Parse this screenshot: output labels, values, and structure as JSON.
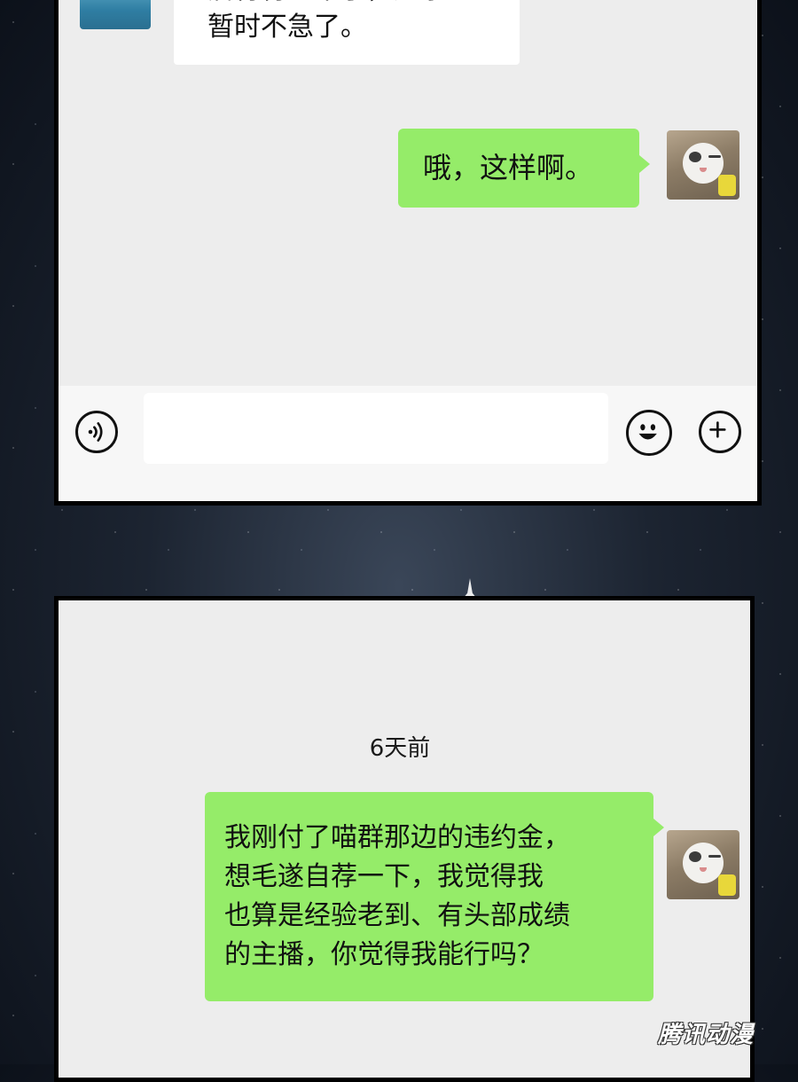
{
  "top_chat": {
    "incoming_message": {
      "partial_first_line": "詹青青过来了，这事",
      "second_line": "暂时不急了。"
    },
    "outgoing_message": "哦，这样啊。"
  },
  "input_bar": {
    "text_value": "",
    "voice_icon": "voice-icon",
    "emoji_icon": "smiley-icon",
    "plus_icon": "plus-icon"
  },
  "bottom_chat": {
    "timestamp": "6天前",
    "outgoing_message_lines": [
      "我刚付了喵群那边的违约金，",
      "想毛遂自荐一下，我觉得我",
      "也算是经验老到、有头部成绩",
      "的主播，你觉得我能行吗？"
    ]
  },
  "watermark": "腾讯动漫",
  "colors": {
    "chat_background": "#ededed",
    "outgoing_bubble": "#95ec69",
    "incoming_bubble": "#ffffff",
    "panel_border": "#000000"
  }
}
